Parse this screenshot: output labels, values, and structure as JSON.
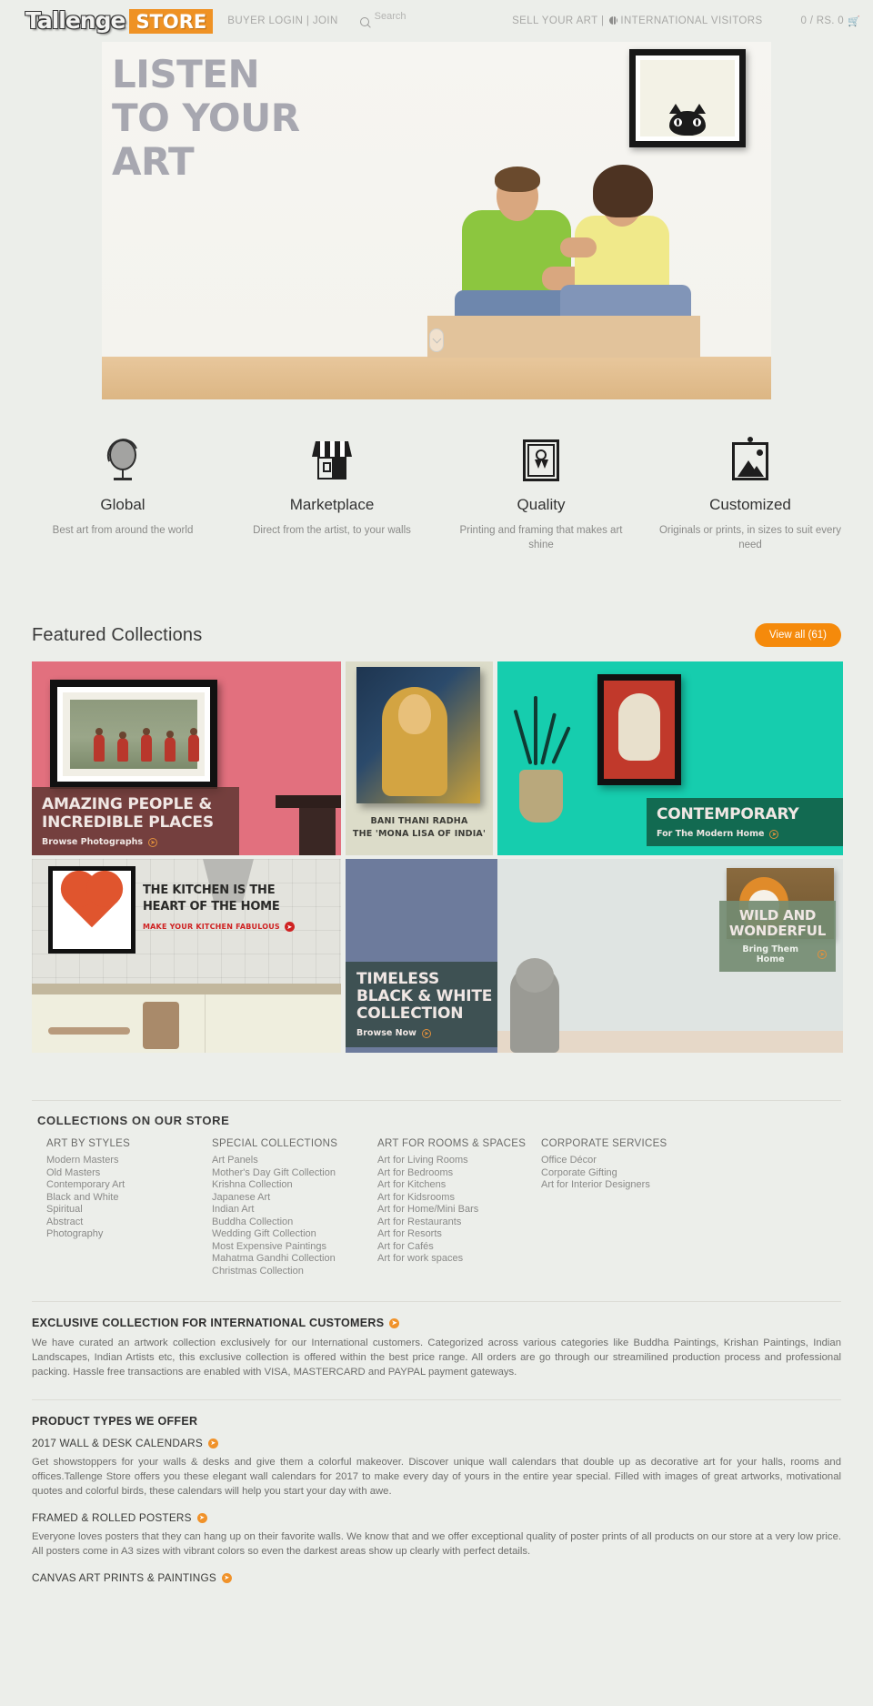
{
  "header": {
    "logo_word": "Tallenge",
    "logo_store": "STORE",
    "buyer_login": "BUYER LOGIN | JOIN",
    "search_placeholder": "Search",
    "sell_your_art": "SELL YOUR ART |",
    "international": "INTERNATIONAL VISITORS",
    "cart": "0 / RS. 0",
    "cart_icon": "cart-icon"
  },
  "hero": {
    "line1": "LISTEN",
    "line2": "TO YOUR",
    "line3": "ART"
  },
  "features": [
    {
      "title": "Global",
      "desc": "Best art from around the world",
      "icon": "globe-icon"
    },
    {
      "title": "Marketplace",
      "desc": "Direct from the artist, to your walls",
      "icon": "shop-icon"
    },
    {
      "title": "Quality",
      "desc": "Printing and framing that makes art shine",
      "icon": "award-frame-icon"
    },
    {
      "title": "Customized",
      "desc": "Originals or prints, in sizes to suit every need",
      "icon": "picture-frame-icon"
    }
  ],
  "featured": {
    "title": "Featured Collections",
    "view_all": "View all (61)",
    "tiles": {
      "people": {
        "line1": "AMAZING PEOPLE &",
        "line2": "INCREDIBLE PLACES",
        "cta": "Browse Photographs"
      },
      "bani": {
        "line1": "BANI THANI RADHA",
        "line2": "THE 'MONA LISA OF INDIA'"
      },
      "contemporary": {
        "line1": "CONTEMPORARY",
        "cta": "For The Modern Home"
      },
      "kitchen": {
        "line1": "THE KITCHEN IS THE",
        "line2": "HEART OF THE HOME",
        "cta": "MAKE YOUR KITCHEN FABULOUS"
      },
      "blackwhite": {
        "line1": "TIMELESS",
        "line2": "BLACK & WHITE",
        "line3": "COLLECTION",
        "cta": "Browse Now"
      },
      "wild": {
        "line1": "WILD AND",
        "line2": "WONDERFUL",
        "cta": "Bring Them Home"
      }
    }
  },
  "collections": {
    "section_title": "COLLECTIONS ON OUR STORE",
    "columns": [
      {
        "heading": "ART BY STYLES",
        "items": [
          "Modern Masters",
          "Old Masters",
          "Contemporary Art",
          "Black and White",
          "Spiritual",
          "Abstract",
          "Photography"
        ]
      },
      {
        "heading": "SPECIAL COLLECTIONS",
        "items": [
          "Art Panels",
          "Mother's Day Gift Collection",
          "Krishna Collection",
          "Japanese Art",
          "Indian Art",
          "Buddha Collection",
          "Wedding Gift Collection",
          "Most Expensive Paintings",
          "Mahatma Gandhi Collection",
          "Christmas Collection"
        ]
      },
      {
        "heading": "ART FOR ROOMS & SPACES",
        "items": [
          "Art for Living Rooms",
          "Art for Bedrooms",
          "Art for Kitchens",
          "Art for Kidsrooms",
          "Art for Home/Mini Bars",
          "Art for Restaurants",
          "Art for Resorts",
          "Art for Cafés",
          "Art for work spaces"
        ]
      },
      {
        "heading": "CORPORATE SERVICES",
        "items": [
          "Office Décor",
          "Corporate Gifting",
          "Art for Interior Designers"
        ]
      }
    ]
  },
  "exclusive": {
    "heading": "EXCLUSIVE COLLECTION FOR INTERNATIONAL CUSTOMERS",
    "body": "We have curated an artwork collection exclusively for our International customers. Categorized across various categories like Buddha Paintings, Krishan Paintings, Indian Landscapes, Indian Artists etc, this exclusive collection is offered within the best price range. All orders are go through our streamilined production process and professional packing. Hassle free transactions are enabled with VISA, MASTERCARD and PAYPAL payment gateways."
  },
  "product_types": {
    "heading": "PRODUCT TYPES WE OFFER",
    "items": [
      {
        "title": "2017 WALL & DESK CALENDARS",
        "body": "Get showstoppers for your walls & desks and give them a colorful makeover. Discover unique wall calendars that double up as decorative art for your halls, rooms and offices.Tallenge Store offers you these elegant wall calendars for 2017 to make every day of yours in the entire year special. Filled with images of great artworks, motivational quotes and colorful birds, these calendars will help you start your day with awe."
      },
      {
        "title": "FRAMED & ROLLED POSTERS",
        "body": "Everyone loves posters that they can hang up on their favorite walls. We know that and we offer exceptional quality of poster prints of all products on our store at a very low price. All posters come in A3 sizes with vibrant colors so even the darkest areas show up clearly with perfect details."
      },
      {
        "title": "CANVAS ART PRINTS & PAINTINGS",
        "body": ""
      }
    ]
  },
  "colors": {
    "brand_orange": "#ef9224",
    "page_bg": "#eceeea",
    "tile_pink": "#e2707e",
    "tile_teal": "#16cdae",
    "tile_blue": "#6d7b9c"
  }
}
